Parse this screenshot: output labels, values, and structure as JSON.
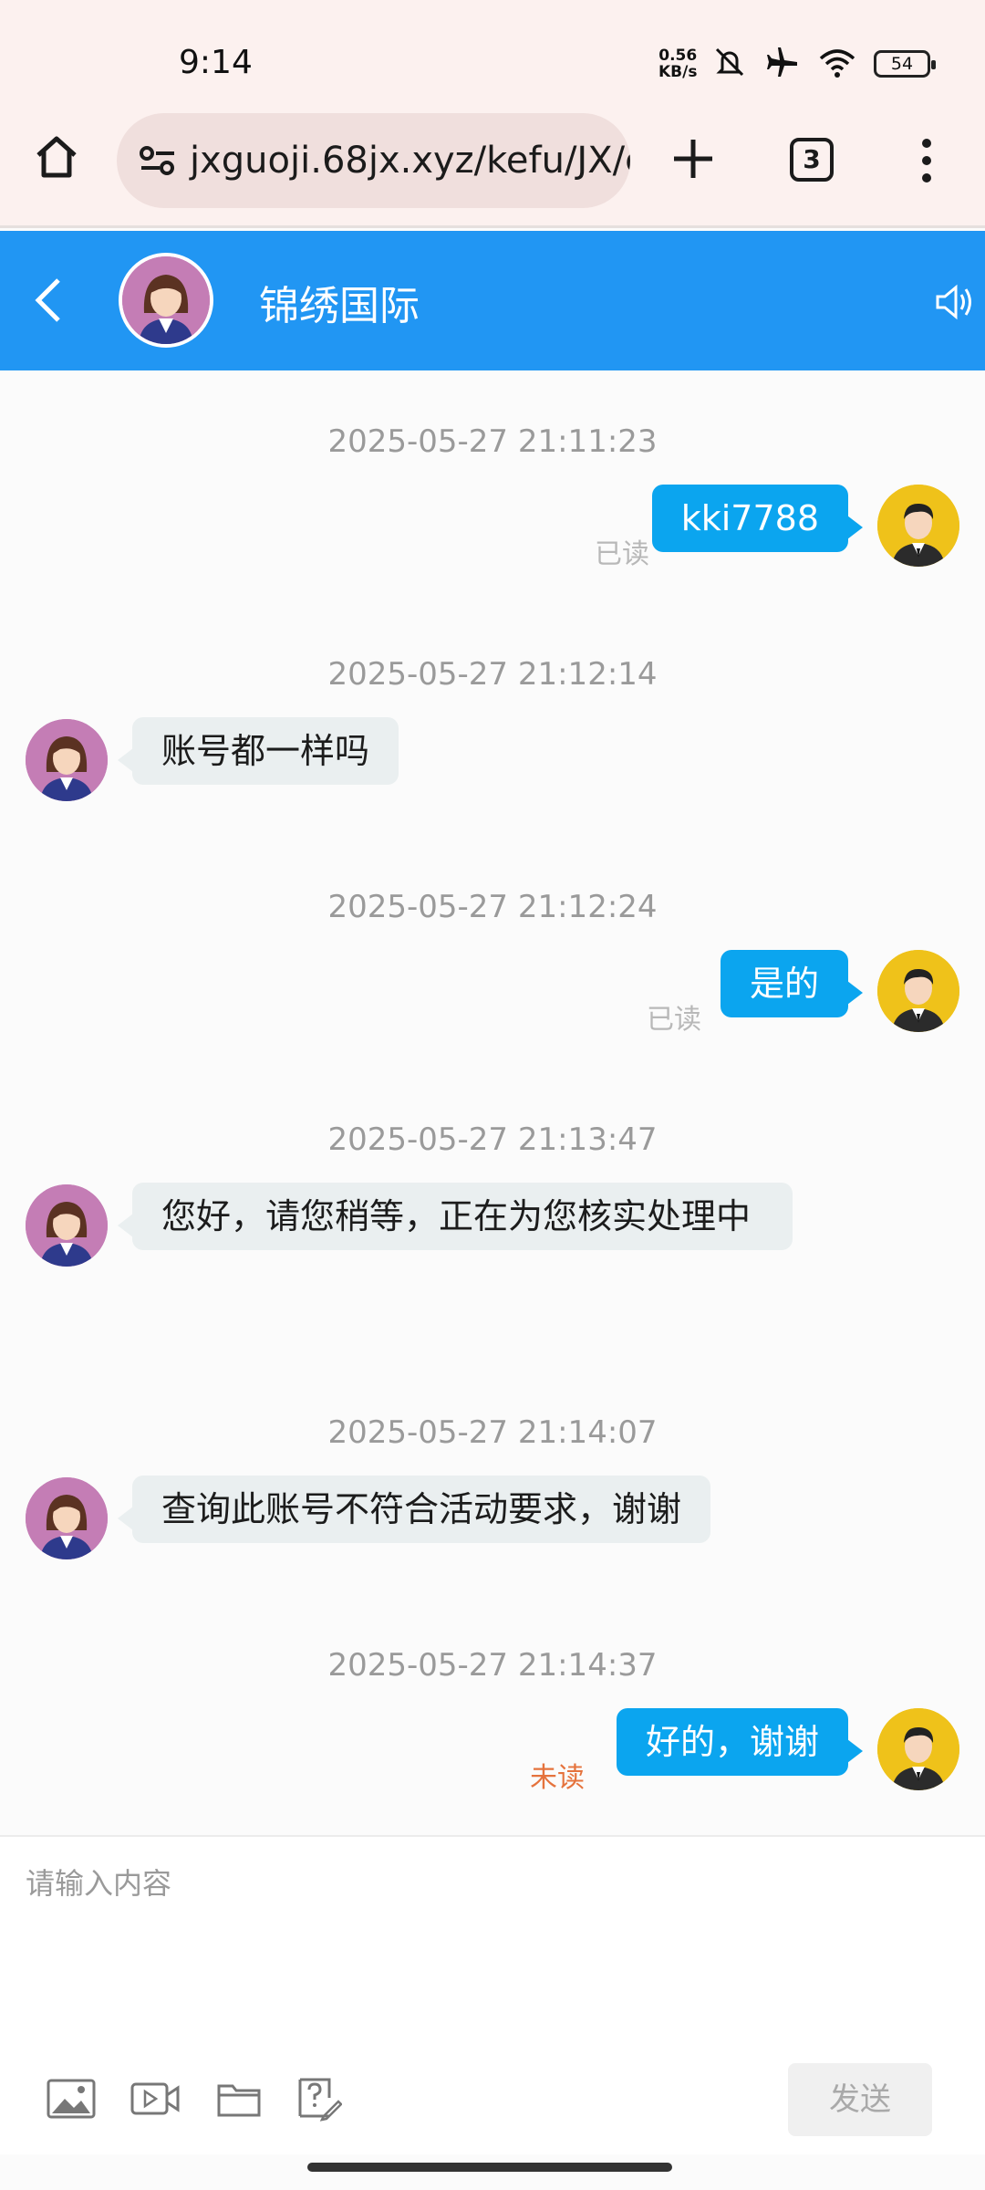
{
  "status_bar": {
    "time": "9:14",
    "network_speed_value": "0.56",
    "network_speed_unit": "KB/s",
    "battery": "54",
    "icons": [
      "mute-icon",
      "airplane-icon",
      "wifi-icon",
      "battery-icon"
    ]
  },
  "browser": {
    "url": "jxguoji.68jx.xyz/kefu/JX/e",
    "tab_count": "3"
  },
  "chat": {
    "title": "锦绣国际",
    "header_color": "#2196f3",
    "messages": [
      {
        "time": "2025-05-27 21:11:23",
        "sender": "user",
        "text": "kki7788",
        "status": "已读"
      },
      {
        "time": "2025-05-27 21:12:14",
        "sender": "agent",
        "text": "账号都一样吗"
      },
      {
        "time": "2025-05-27 21:12:24",
        "sender": "user",
        "text": "是的",
        "status": "已读"
      },
      {
        "time": "2025-05-27 21:13:47",
        "sender": "agent",
        "text": "您好，请您稍等，正在为您核实处理中"
      },
      {
        "time": "2025-05-27 21:14:07",
        "sender": "agent",
        "text": "查询此账号不符合活动要求，谢谢"
      },
      {
        "time": "2025-05-27 21:14:37",
        "sender": "user",
        "text": "好的，谢谢",
        "status": "未读"
      }
    ]
  },
  "composer": {
    "placeholder": "请输入内容",
    "send_label": "发送",
    "tools": [
      "image-icon",
      "video-icon",
      "folder-icon",
      "question-icon"
    ]
  },
  "colors": {
    "user_bubble": "#0ba5ef",
    "agent_bubble": "#eaeff0",
    "unread": "#e5733d"
  }
}
